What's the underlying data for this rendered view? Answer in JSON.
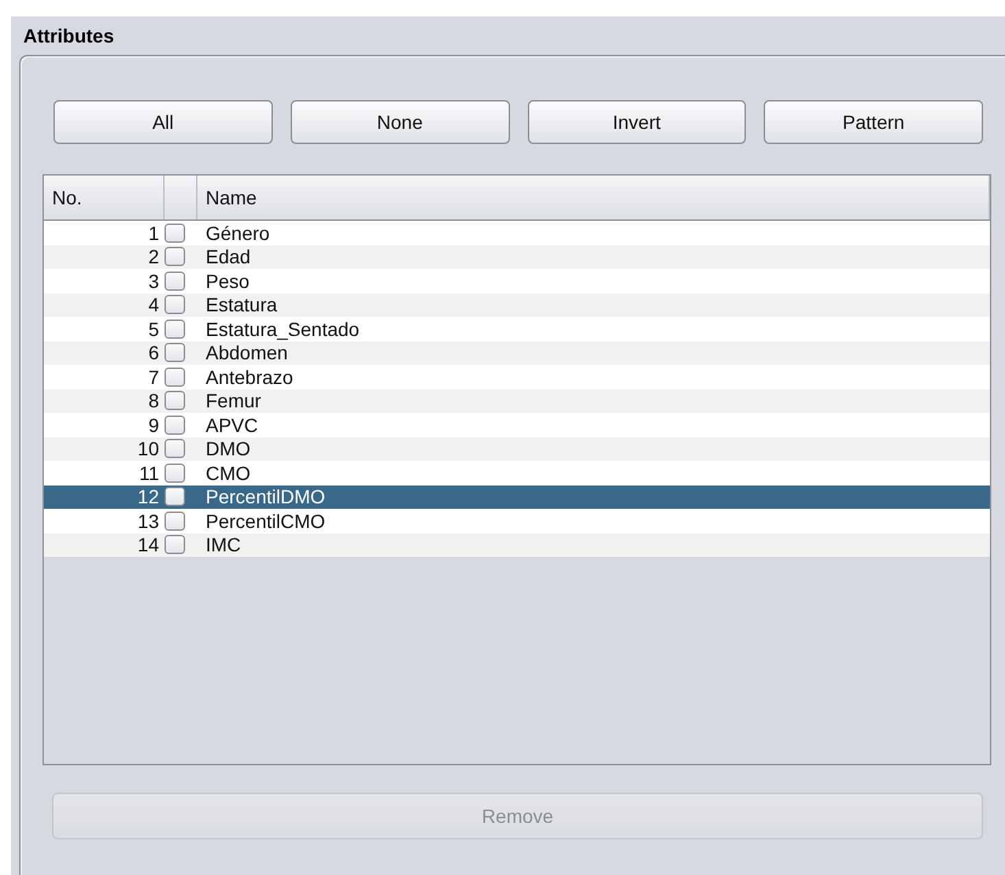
{
  "panel": {
    "title": "Attributes"
  },
  "buttons": [
    {
      "label": "All"
    },
    {
      "label": "None"
    },
    {
      "label": "Invert"
    },
    {
      "label": "Pattern"
    }
  ],
  "table": {
    "columns": [
      "No.",
      "",
      "Name"
    ],
    "rows": [
      {
        "no": "1",
        "name": "Género",
        "checked": false,
        "selected": false
      },
      {
        "no": "2",
        "name": "Edad",
        "checked": false,
        "selected": false
      },
      {
        "no": "3",
        "name": "Peso",
        "checked": false,
        "selected": false
      },
      {
        "no": "4",
        "name": "Estatura",
        "checked": false,
        "selected": false
      },
      {
        "no": "5",
        "name": "Estatura_Sentado",
        "checked": false,
        "selected": false
      },
      {
        "no": "6",
        "name": "Abdomen",
        "checked": false,
        "selected": false
      },
      {
        "no": "7",
        "name": "Antebrazo",
        "checked": false,
        "selected": false
      },
      {
        "no": "8",
        "name": "Femur",
        "checked": false,
        "selected": false
      },
      {
        "no": "9",
        "name": "APVC",
        "checked": false,
        "selected": false
      },
      {
        "no": "10",
        "name": "DMO",
        "checked": false,
        "selected": false
      },
      {
        "no": "11",
        "name": "CMO",
        "checked": false,
        "selected": false
      },
      {
        "no": "12",
        "name": "PercentilDMO",
        "checked": false,
        "selected": true
      },
      {
        "no": "13",
        "name": "PercentilCMO",
        "checked": false,
        "selected": false
      },
      {
        "no": "14",
        "name": "IMC",
        "checked": false,
        "selected": false
      }
    ]
  },
  "remove_button": {
    "label": "Remove",
    "disabled": true
  }
}
